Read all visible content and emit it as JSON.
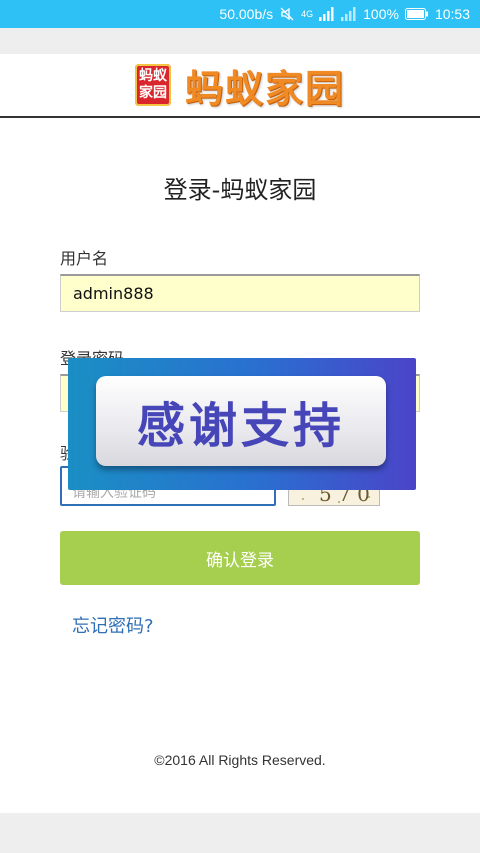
{
  "status_bar": {
    "network_speed": "50.00b/s",
    "network_type": "4G",
    "battery": "100%",
    "time": "10:53"
  },
  "header": {
    "logo_mark_top": "蚂蚁",
    "logo_mark_bottom": "家园",
    "logo_text": "蚂蚁家园"
  },
  "page_title": "登录-蚂蚁家园",
  "form": {
    "username_label": "用户名",
    "username_value": "admin888",
    "password_label": "登录密码",
    "captcha_label": "验",
    "captcha_placeholder": "请输入验证码",
    "captcha_text": "5 7 0"
  },
  "overlay": {
    "text": "感谢支持"
  },
  "login_button_label": "确认登录",
  "forgot_password_link": "忘记密码?",
  "footer_text": "©2016 All Rights Reserved."
}
